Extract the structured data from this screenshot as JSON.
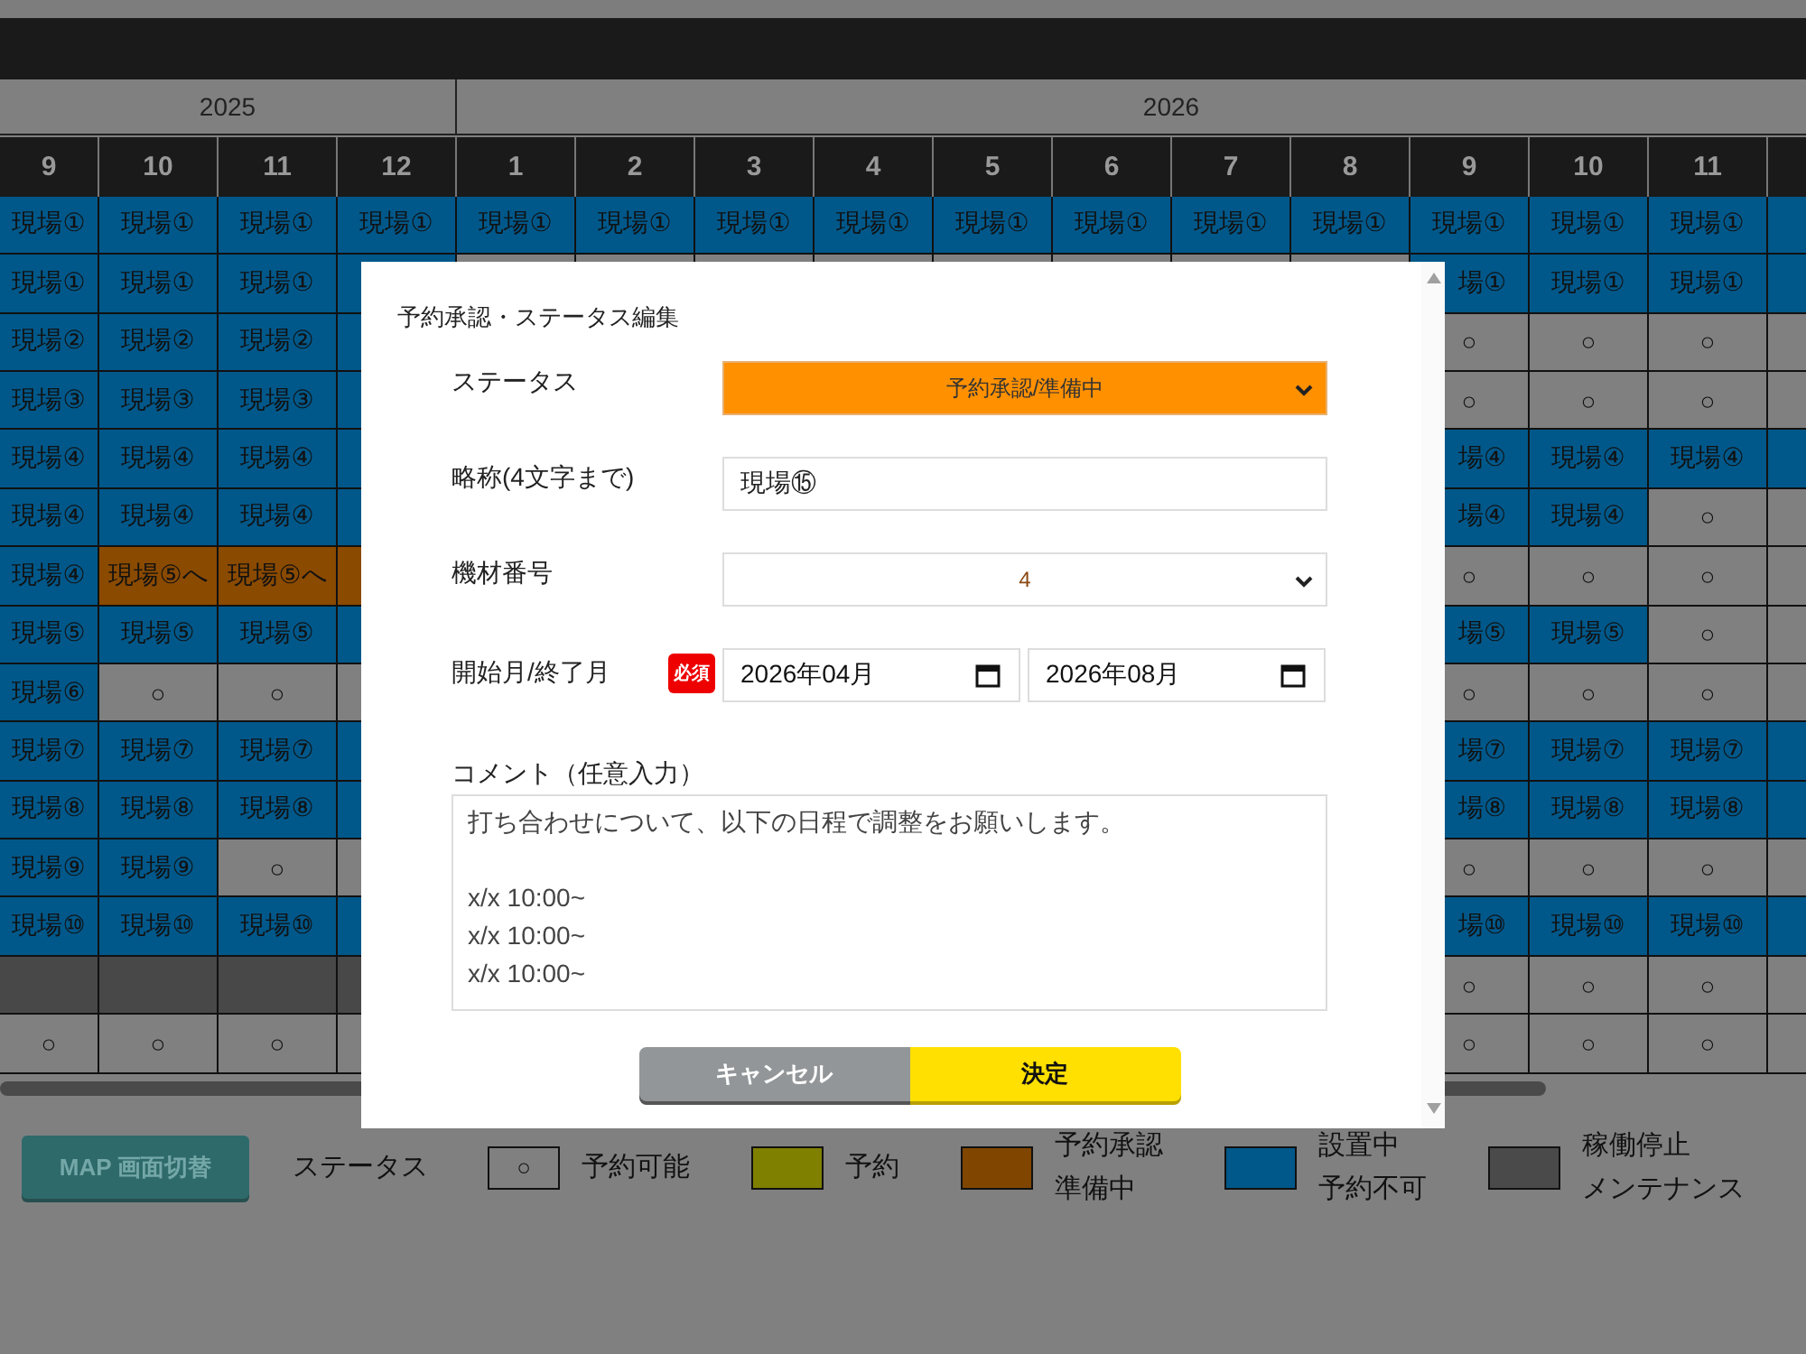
{
  "schedule": {
    "years": [
      {
        "label": "2025",
        "months": [
          "9",
          "10",
          "11",
          "12"
        ]
      },
      {
        "label": "2026",
        "months": [
          "1",
          "2",
          "3",
          "4",
          "5",
          "6",
          "7",
          "8",
          "9",
          "10",
          "11"
        ]
      }
    ],
    "rows": [
      {
        "cells": [
          {
            "kind": "site",
            "text": "現場①"
          },
          {
            "kind": "site",
            "text": "現場①"
          },
          {
            "kind": "site",
            "text": "現場①"
          },
          {
            "kind": "site",
            "text": "現場①"
          },
          {
            "kind": "site",
            "text": "現場①"
          },
          {
            "kind": "site",
            "text": "現場①"
          },
          {
            "kind": "site",
            "text": "現場①"
          },
          {
            "kind": "site",
            "text": "現場①"
          },
          {
            "kind": "site",
            "text": "現場①"
          },
          {
            "kind": "site",
            "text": "現場①"
          },
          {
            "kind": "site",
            "text": "現場①"
          },
          {
            "kind": "site",
            "text": "現場①"
          },
          {
            "kind": "site",
            "text": "現場①"
          },
          {
            "kind": "site",
            "text": "現場①"
          },
          {
            "kind": "site",
            "text": "現場①"
          },
          {
            "kind": "site"
          }
        ]
      },
      {
        "cells": [
          {
            "kind": "site",
            "text": "現場①"
          },
          {
            "kind": "site",
            "text": "現場①"
          },
          {
            "kind": "site",
            "text": "現場①"
          },
          {
            "kind": "site"
          },
          {
            "kind": "hidden"
          },
          {
            "kind": "hidden"
          },
          {
            "kind": "hidden"
          },
          {
            "kind": "hidden"
          },
          {
            "kind": "hidden"
          },
          {
            "kind": "hidden"
          },
          {
            "kind": "hidden"
          },
          {
            "kind": "hidden"
          },
          {
            "kind": "site",
            "text": "場①",
            "cut_start": true
          },
          {
            "kind": "site",
            "text": "現場①"
          },
          {
            "kind": "site",
            "text": "現場①"
          },
          {
            "kind": "site"
          }
        ]
      },
      {
        "cells": [
          {
            "kind": "site",
            "text": "現場②"
          },
          {
            "kind": "site",
            "text": "現場②"
          },
          {
            "kind": "site",
            "text": "現場②"
          },
          {
            "kind": "site"
          },
          {
            "kind": "hidden"
          },
          {
            "kind": "hidden"
          },
          {
            "kind": "hidden"
          },
          {
            "kind": "hidden"
          },
          {
            "kind": "hidden"
          },
          {
            "kind": "hidden"
          },
          {
            "kind": "hidden"
          },
          {
            "kind": "hidden"
          },
          {
            "kind": "open",
            "text": "○"
          },
          {
            "kind": "open",
            "text": "○"
          },
          {
            "kind": "open",
            "text": "○"
          },
          {
            "kind": "open"
          }
        ]
      },
      {
        "cells": [
          {
            "kind": "site",
            "text": "現場③"
          },
          {
            "kind": "site",
            "text": "現場③"
          },
          {
            "kind": "site",
            "text": "現場③"
          },
          {
            "kind": "site"
          },
          {
            "kind": "hidden"
          },
          {
            "kind": "hidden"
          },
          {
            "kind": "hidden"
          },
          {
            "kind": "hidden"
          },
          {
            "kind": "hidden"
          },
          {
            "kind": "hidden"
          },
          {
            "kind": "hidden"
          },
          {
            "kind": "hidden"
          },
          {
            "kind": "open",
            "text": "○"
          },
          {
            "kind": "open",
            "text": "○"
          },
          {
            "kind": "open",
            "text": "○"
          },
          {
            "kind": "open"
          }
        ]
      },
      {
        "cells": [
          {
            "kind": "site",
            "text": "現場④"
          },
          {
            "kind": "site",
            "text": "現場④"
          },
          {
            "kind": "site",
            "text": "現場④"
          },
          {
            "kind": "site"
          },
          {
            "kind": "hidden"
          },
          {
            "kind": "hidden"
          },
          {
            "kind": "hidden"
          },
          {
            "kind": "hidden"
          },
          {
            "kind": "hidden"
          },
          {
            "kind": "hidden"
          },
          {
            "kind": "hidden"
          },
          {
            "kind": "hidden"
          },
          {
            "kind": "site",
            "text": "場④",
            "cut_start": true
          },
          {
            "kind": "site",
            "text": "現場④"
          },
          {
            "kind": "site",
            "text": "現場④"
          },
          {
            "kind": "site"
          }
        ]
      },
      {
        "cells": [
          {
            "kind": "site",
            "text": "現場④"
          },
          {
            "kind": "site",
            "text": "現場④"
          },
          {
            "kind": "site",
            "text": "現場④"
          },
          {
            "kind": "site"
          },
          {
            "kind": "hidden"
          },
          {
            "kind": "hidden"
          },
          {
            "kind": "hidden"
          },
          {
            "kind": "hidden"
          },
          {
            "kind": "hidden"
          },
          {
            "kind": "hidden"
          },
          {
            "kind": "hidden"
          },
          {
            "kind": "hidden"
          },
          {
            "kind": "site",
            "text": "場④",
            "cut_start": true
          },
          {
            "kind": "site",
            "text": "現場④"
          },
          {
            "kind": "open",
            "text": "○"
          },
          {
            "kind": "open"
          }
        ]
      },
      {
        "cells": [
          {
            "kind": "site",
            "text": "現場④"
          },
          {
            "kind": "prep",
            "text": "現場⑤へ"
          },
          {
            "kind": "prep",
            "text": "現場⑤へ"
          },
          {
            "kind": "prep"
          },
          {
            "kind": "hidden"
          },
          {
            "kind": "hidden"
          },
          {
            "kind": "hidden"
          },
          {
            "kind": "hidden"
          },
          {
            "kind": "hidden"
          },
          {
            "kind": "hidden"
          },
          {
            "kind": "hidden"
          },
          {
            "kind": "hidden"
          },
          {
            "kind": "open",
            "text": "○"
          },
          {
            "kind": "open",
            "text": "○"
          },
          {
            "kind": "open",
            "text": "○"
          },
          {
            "kind": "open"
          }
        ]
      },
      {
        "cells": [
          {
            "kind": "site",
            "text": "現場⑤"
          },
          {
            "kind": "site",
            "text": "現場⑤"
          },
          {
            "kind": "site",
            "text": "現場⑤"
          },
          {
            "kind": "site"
          },
          {
            "kind": "hidden"
          },
          {
            "kind": "hidden"
          },
          {
            "kind": "hidden"
          },
          {
            "kind": "hidden"
          },
          {
            "kind": "hidden"
          },
          {
            "kind": "hidden"
          },
          {
            "kind": "hidden"
          },
          {
            "kind": "hidden"
          },
          {
            "kind": "site",
            "text": "場⑤",
            "cut_start": true
          },
          {
            "kind": "site",
            "text": "現場⑤"
          },
          {
            "kind": "open",
            "text": "○"
          },
          {
            "kind": "open"
          }
        ]
      },
      {
        "cells": [
          {
            "kind": "site",
            "text": "現場⑥"
          },
          {
            "kind": "open",
            "text": "○"
          },
          {
            "kind": "open",
            "text": "○"
          },
          {
            "kind": "open"
          },
          {
            "kind": "hidden"
          },
          {
            "kind": "hidden"
          },
          {
            "kind": "hidden"
          },
          {
            "kind": "hidden"
          },
          {
            "kind": "hidden"
          },
          {
            "kind": "hidden"
          },
          {
            "kind": "hidden"
          },
          {
            "kind": "hidden"
          },
          {
            "kind": "open",
            "text": "○"
          },
          {
            "kind": "open",
            "text": "○"
          },
          {
            "kind": "open",
            "text": "○"
          },
          {
            "kind": "open"
          }
        ]
      },
      {
        "cells": [
          {
            "kind": "site",
            "text": "現場⑦"
          },
          {
            "kind": "site",
            "text": "現場⑦"
          },
          {
            "kind": "site",
            "text": "現場⑦"
          },
          {
            "kind": "site"
          },
          {
            "kind": "hidden"
          },
          {
            "kind": "hidden"
          },
          {
            "kind": "hidden"
          },
          {
            "kind": "hidden"
          },
          {
            "kind": "hidden"
          },
          {
            "kind": "hidden"
          },
          {
            "kind": "hidden"
          },
          {
            "kind": "hidden"
          },
          {
            "kind": "site",
            "text": "場⑦",
            "cut_start": true
          },
          {
            "kind": "site",
            "text": "現場⑦"
          },
          {
            "kind": "site",
            "text": "現場⑦"
          },
          {
            "kind": "site"
          }
        ]
      },
      {
        "cells": [
          {
            "kind": "site",
            "text": "現場⑧"
          },
          {
            "kind": "site",
            "text": "現場⑧"
          },
          {
            "kind": "site",
            "text": "現場⑧"
          },
          {
            "kind": "site"
          },
          {
            "kind": "hidden"
          },
          {
            "kind": "hidden"
          },
          {
            "kind": "hidden"
          },
          {
            "kind": "hidden"
          },
          {
            "kind": "hidden"
          },
          {
            "kind": "hidden"
          },
          {
            "kind": "hidden"
          },
          {
            "kind": "hidden"
          },
          {
            "kind": "site",
            "text": "場⑧",
            "cut_start": true
          },
          {
            "kind": "site",
            "text": "現場⑧"
          },
          {
            "kind": "site",
            "text": "現場⑧"
          },
          {
            "kind": "site"
          }
        ]
      },
      {
        "cells": [
          {
            "kind": "site",
            "text": "現場⑨"
          },
          {
            "kind": "site",
            "text": "現場⑨"
          },
          {
            "kind": "open",
            "text": "○"
          },
          {
            "kind": "open"
          },
          {
            "kind": "hidden"
          },
          {
            "kind": "hidden"
          },
          {
            "kind": "hidden"
          },
          {
            "kind": "hidden"
          },
          {
            "kind": "hidden"
          },
          {
            "kind": "hidden"
          },
          {
            "kind": "hidden"
          },
          {
            "kind": "hidden"
          },
          {
            "kind": "open",
            "text": "○"
          },
          {
            "kind": "open",
            "text": "○"
          },
          {
            "kind": "open",
            "text": "○"
          },
          {
            "kind": "open"
          }
        ]
      },
      {
        "cells": [
          {
            "kind": "site",
            "text": "現場⑩"
          },
          {
            "kind": "site",
            "text": "現場⑩"
          },
          {
            "kind": "site",
            "text": "現場⑩"
          },
          {
            "kind": "site"
          },
          {
            "kind": "hidden"
          },
          {
            "kind": "hidden"
          },
          {
            "kind": "hidden"
          },
          {
            "kind": "hidden"
          },
          {
            "kind": "hidden"
          },
          {
            "kind": "hidden"
          },
          {
            "kind": "hidden"
          },
          {
            "kind": "hidden"
          },
          {
            "kind": "site",
            "text": "場⑩",
            "cut_start": true
          },
          {
            "kind": "site",
            "text": "現場⑩"
          },
          {
            "kind": "site",
            "text": "現場⑩"
          },
          {
            "kind": "site"
          }
        ]
      },
      {
        "cells": [
          {
            "kind": "stopped"
          },
          {
            "kind": "stopped"
          },
          {
            "kind": "stopped"
          },
          {
            "kind": "stopped"
          },
          {
            "kind": "hidden"
          },
          {
            "kind": "hidden"
          },
          {
            "kind": "hidden"
          },
          {
            "kind": "hidden"
          },
          {
            "kind": "hidden"
          },
          {
            "kind": "hidden"
          },
          {
            "kind": "hidden"
          },
          {
            "kind": "hidden"
          },
          {
            "kind": "open",
            "text": "○"
          },
          {
            "kind": "open",
            "text": "○"
          },
          {
            "kind": "open",
            "text": "○"
          },
          {
            "kind": "open"
          }
        ]
      },
      {
        "cells": [
          {
            "kind": "open",
            "text": "○"
          },
          {
            "kind": "open",
            "text": "○"
          },
          {
            "kind": "open",
            "text": "○"
          },
          {
            "kind": "open"
          },
          {
            "kind": "hidden"
          },
          {
            "kind": "hidden"
          },
          {
            "kind": "hidden"
          },
          {
            "kind": "hidden"
          },
          {
            "kind": "hidden"
          },
          {
            "kind": "hidden"
          },
          {
            "kind": "hidden"
          },
          {
            "kind": "hidden"
          },
          {
            "kind": "open",
            "text": "○"
          },
          {
            "kind": "open",
            "text": "○"
          },
          {
            "kind": "open",
            "text": "○"
          },
          {
            "kind": "open"
          }
        ]
      }
    ]
  },
  "map_button": "MAP 画面切替",
  "legend": {
    "title": "ステータス",
    "items": [
      {
        "kind": "symbol",
        "symbol": "○",
        "lines": [
          "予約可能"
        ],
        "color": "#808080"
      },
      {
        "kind": "swatch",
        "lines": [
          "予約"
        ],
        "color": "#808000"
      },
      {
        "kind": "swatch",
        "lines": [
          "予約承認",
          "準備中"
        ],
        "color": "#804600"
      },
      {
        "kind": "swatch",
        "lines": [
          "設置中",
          "予約不可"
        ],
        "color": "#00588a"
      },
      {
        "kind": "swatch",
        "lines": [
          "稼働停止",
          "メンテナンス"
        ],
        "color": "#4a4a4a"
      }
    ]
  },
  "dialog": {
    "title": "予約承認・ステータス編集",
    "fields": [
      {
        "kind": "select",
        "label": "ステータス",
        "value": "予約承認/準備中",
        "highlight": true
      },
      {
        "kind": "text",
        "label": "略称(4文字まで)",
        "value": "現場⑮"
      },
      {
        "kind": "select",
        "label": "機材番号",
        "value": "4",
        "highlight": false
      },
      {
        "kind": "months",
        "label": "開始月/終了月",
        "required": "必須",
        "values": [
          "2026年04月",
          "2026年08月"
        ]
      },
      {
        "kind": "textarea",
        "label": "コメント（任意入力）",
        "value": "打ち合わせについて、以下の日程で調整をお願いします。\n\nx/x 10:00~\nx/x 10:00~\nx/x 10:00~"
      }
    ],
    "buttons": [
      {
        "kind": "cancel",
        "label": "キャンセル"
      },
      {
        "kind": "ok",
        "label": "決定"
      }
    ]
  }
}
